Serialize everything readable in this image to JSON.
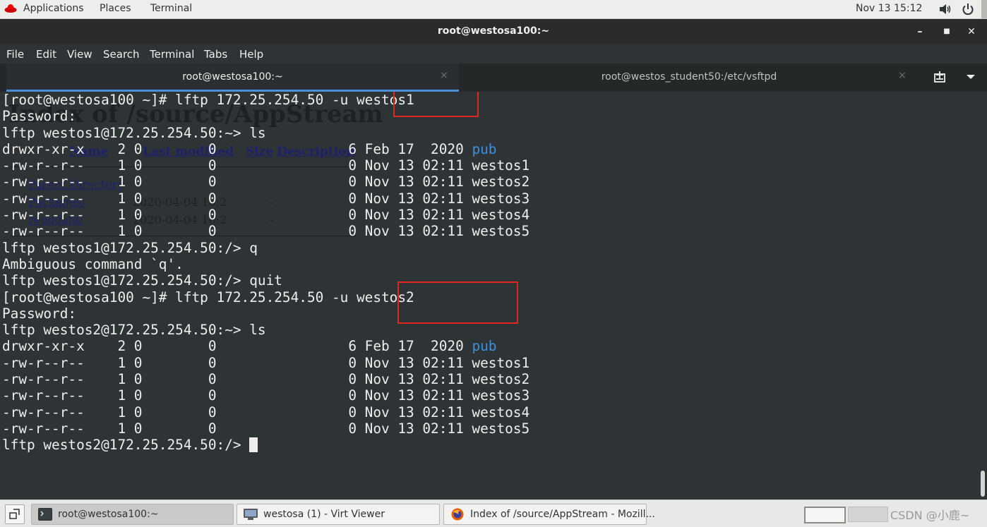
{
  "topbar": {
    "applications": "Applications",
    "places": "Places",
    "terminal": "Terminal",
    "datetime": "Nov 13  15:12"
  },
  "window": {
    "title": "root@westosa100:~",
    "minimize": "–",
    "maximize": "■",
    "close": "✕"
  },
  "menubar": {
    "items": [
      "File",
      "Edit",
      "View",
      "Search",
      "Terminal",
      "Tabs",
      "Help"
    ]
  },
  "tabs": [
    {
      "label": "root@westosa100:~",
      "active": true,
      "close": "×"
    },
    {
      "label": "root@westos_student50:/etc/vsftpd",
      "active": false,
      "close": "×"
    }
  ],
  "ghost_window": {
    "title": "Index of /source/AppStream",
    "columns": [
      "Name",
      "Last modified",
      "Size",
      "Description"
    ],
    "rows": [
      {
        "name": "Parent Directory",
        "modified": "",
        "size": ""
      },
      {
        "name": "Packages/",
        "modified": "2020-04-04 16:2",
        "size": "-"
      },
      {
        "name": "repodata/",
        "modified": "2020-04-04 16:2",
        "size": "-"
      }
    ]
  },
  "terminal": {
    "lines": [
      "[root@westosa100 ~]# lftp 172.25.254.50 -u westos1",
      "Password:",
      "lftp westos1@172.25.254.50:~> ls",
      {
        "text": "drwxr-xr-x    2 0        0                6 Feb 17  2020 ",
        "link": "pub"
      },
      "-rw-r--r--    1 0        0                0 Nov 13 02:11 westos1",
      "-rw-r--r--    1 0        0                0 Nov 13 02:11 westos2",
      "-rw-r--r--    1 0        0                0 Nov 13 02:11 westos3",
      "-rw-r--r--    1 0        0                0 Nov 13 02:11 westos4",
      "-rw-r--r--    1 0        0                0 Nov 13 02:11 westos5",
      "lftp westos1@172.25.254.50:/> q",
      "Ambiguous command `q'.",
      "lftp westos1@172.25.254.50:/> quit",
      "[root@westosa100 ~]# lftp 172.25.254.50 -u westos2",
      "Password:",
      "lftp westos2@172.25.254.50:~> ls",
      {
        "text": "drwxr-xr-x    2 0        0                6 Feb 17  2020 ",
        "link": "pub"
      },
      "-rw-r--r--    1 0        0                0 Nov 13 02:11 westos1",
      "-rw-r--r--    1 0        0                0 Nov 13 02:11 westos2",
      "-rw-r--r--    1 0        0                0 Nov 13 02:11 westos3",
      "-rw-r--r--    1 0        0                0 Nov 13 02:11 westos4",
      "-rw-r--r--    1 0        0                0 Nov 13 02:11 westos5",
      {
        "text": "lftp westos2@172.25.254.50:/> ",
        "cursor": true
      }
    ],
    "colors": {
      "background": "#2e3436",
      "foreground": "#eeeeec",
      "directory": "#3c8fe0",
      "highlight": "#e0261f"
    }
  },
  "taskbar": {
    "tasks": [
      {
        "label": "root@westosa100:~",
        "icon": "terminal-icon"
      },
      {
        "label": "westosa (1) - Virt Viewer",
        "icon": "virt-viewer-icon"
      },
      {
        "label": "Index of /source/AppStream - Mozill...",
        "icon": "firefox-icon"
      }
    ],
    "watermark": "CSDN @小鹿~"
  }
}
